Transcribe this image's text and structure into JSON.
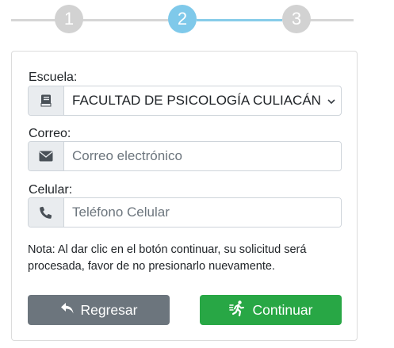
{
  "stepper": {
    "steps": [
      {
        "label": "1",
        "state": "inactive"
      },
      {
        "label": "2",
        "state": "active"
      },
      {
        "label": "3",
        "state": "inactive"
      }
    ],
    "colors": {
      "active": "#7fc9ea",
      "inactive": "#d2d2d2"
    }
  },
  "form": {
    "school": {
      "label": "Escuela:",
      "icon": "book-icon",
      "selected": "FACULTAD DE PSICOLOGÍA CULIACÁN"
    },
    "email": {
      "label": "Correo:",
      "icon": "envelope-icon",
      "value": "",
      "placeholder": "Correo electrónico"
    },
    "phone": {
      "label": "Celular:",
      "icon": "phone-icon",
      "value": "",
      "placeholder": "Teléfono Celular"
    },
    "note": "Nota: Al dar clic en el botón continuar, su solicitud será procesada, favor de no presionarlo nuevamente."
  },
  "actions": {
    "back": {
      "label": "Regresar",
      "icon": "undo-arrow-icon",
      "color": "#6c757d"
    },
    "next": {
      "label": "Continuar",
      "icon": "running-person-icon",
      "color": "#28a745"
    }
  }
}
